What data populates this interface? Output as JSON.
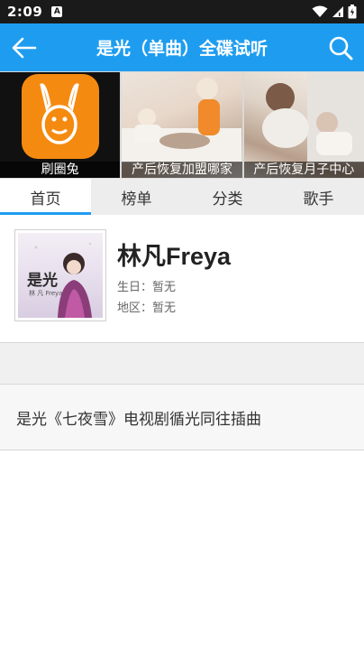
{
  "status": {
    "time": "2:09",
    "notif_icon": "A",
    "icons": [
      "wifi-icon",
      "signal-icon",
      "battery-icon"
    ]
  },
  "appbar": {
    "title": "是光（单曲）全碟试听",
    "back_icon": "back-arrow-icon",
    "search_icon": "search-icon",
    "color": "#1e9df0"
  },
  "banners": [
    {
      "caption": "刷圈兔"
    },
    {
      "caption": "产后恢复加盟哪家"
    },
    {
      "caption": "产后恢复月子中心"
    }
  ],
  "tabs": [
    {
      "label": "首页",
      "active": true
    },
    {
      "label": "榜单"
    },
    {
      "label": "分类"
    },
    {
      "label": "歌手"
    }
  ],
  "artist": {
    "name": "林凡Freya",
    "birthday": "生日：暂无",
    "region": "地区：暂无",
    "cover_text": "是光",
    "cover_caption": "林 凡 Freya"
  },
  "description": "是光《七夜雪》电视剧循光同往插曲"
}
